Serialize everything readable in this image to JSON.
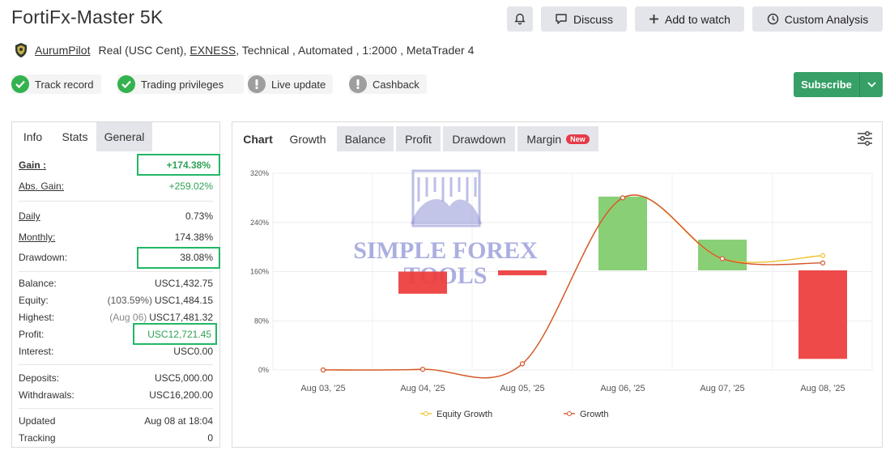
{
  "header": {
    "title": "FortiFx-Master 5K",
    "discuss_label": "Discuss",
    "watch_label": "Add to watch",
    "analysis_label": "Custom Analysis"
  },
  "meta": {
    "author": "AurumPilot",
    "account_type": "Real (USC Cent),",
    "broker": "EXNESS",
    "details": ", Technical , Automated , 1:2000 , MetaTrader 4"
  },
  "badges": [
    {
      "label": "Track record",
      "status": "verified",
      "color": "#34b24f"
    },
    {
      "label": "Trading privileges",
      "status": "verified",
      "color": "#34b24f"
    },
    {
      "label": "Live update",
      "status": "warning",
      "color": "#9e9e9e"
    },
    {
      "label": "Cashback",
      "status": "warning",
      "color": "#9e9e9e"
    }
  ],
  "subscribe": {
    "label": "Subscribe",
    "color": "#36a067"
  },
  "stats_panel": {
    "tabs": [
      "Info",
      "Stats",
      "General"
    ],
    "gain": {
      "label": "Gain :",
      "value": "+174.38%"
    },
    "abs_gain": {
      "label": "Abs. Gain:",
      "value": "+259.02%"
    },
    "daily": {
      "label": "Daily",
      "value": "0.73%"
    },
    "monthly": {
      "label": "Monthly:",
      "value": "174.38%"
    },
    "drawdown": {
      "label": "Drawdown:",
      "value": "38.08%"
    },
    "balance": {
      "label": "Balance:",
      "value": "USC1,432.75"
    },
    "equity": {
      "label": "Equity:",
      "pct": "(103.59%)",
      "value": "USC1,484.15"
    },
    "highest": {
      "label": "Highest:",
      "date": "(Aug 06)",
      "value": "USC17,481.32"
    },
    "profit": {
      "label": "Profit:",
      "value": "USC12,721.45"
    },
    "interest": {
      "label": "Interest:",
      "value": "USC0.00"
    },
    "deposits": {
      "label": "Deposits:",
      "value": "USC5,000.00"
    },
    "withdrawals": {
      "label": "Withdrawals:",
      "value": "USC16,200.00"
    },
    "updated": {
      "label": "Updated",
      "value": "Aug 08 at 18:04"
    },
    "tracking": {
      "label": "Tracking",
      "value": "0"
    },
    "highlight_color": "#21b766"
  },
  "chart_tabs": {
    "chart": "Chart",
    "growth": "Growth",
    "balance": "Balance",
    "profit": "Profit",
    "drawdown": "Drawdown",
    "margin": "Margin",
    "new_badge": "New"
  },
  "watermark": {
    "line1": "SIMPLE FOREX",
    "line2": "TOOLS"
  },
  "chart_data": {
    "type": "line",
    "categories": [
      "Aug 03, '25",
      "Aug 04, '25",
      "Aug 05, '25",
      "Aug 06, '25",
      "Aug 07, '25",
      "Aug 08, '25"
    ],
    "ylim": [
      0,
      320
    ],
    "yticks": [
      "0%",
      "80%",
      "160%",
      "240%",
      "320%"
    ],
    "grid": true,
    "legend_position": "bottom",
    "series": [
      {
        "name": "Equity Growth",
        "color": "#f2c12e",
        "values": [
          0,
          1,
          10,
          280,
          181,
          186
        ]
      },
      {
        "name": "Growth",
        "color": "#d4562e",
        "values": [
          0,
          1,
          10,
          280,
          181,
          174
        ]
      }
    ],
    "bars": [
      {
        "category": "Aug 04, '25",
        "from": 160,
        "to": 124,
        "color": "#ee3b3b"
      },
      {
        "category": "Aug 05, '25",
        "from": 162,
        "to": 154,
        "color": "#ee3b3b"
      },
      {
        "category": "Aug 06, '25",
        "from": 162,
        "to": 282,
        "color": "#7ecb6a"
      },
      {
        "category": "Aug 07, '25",
        "from": 162,
        "to": 212,
        "color": "#7ecb6a"
      },
      {
        "category": "Aug 08, '25",
        "from": 162,
        "to": 18,
        "color": "#ee3b3b"
      }
    ]
  }
}
